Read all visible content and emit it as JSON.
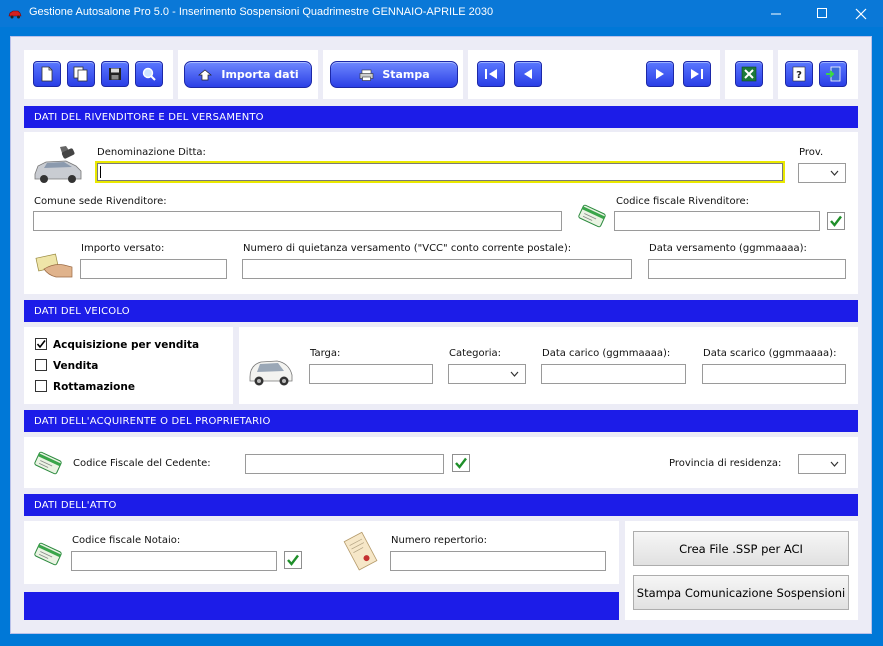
{
  "window": {
    "title": "Gestione Autosalone Pro 5.0 - Inserimento Sospensioni Quadrimestre GENNAIO-APRILE 2030",
    "minimize_glyph": "—",
    "maximize_glyph": "☐",
    "close_glyph": "✕"
  },
  "toolbar": {
    "import_label": "Importa dati",
    "print_label": "Stampa",
    "icons": [
      "new-doc-icon",
      "copy-icon",
      "save-icon",
      "search-icon",
      "first-record-icon",
      "prev-record-icon",
      "next-record-icon",
      "last-record-icon",
      "excel-icon",
      "help-icon",
      "exit-icon"
    ]
  },
  "sections": {
    "rivenditore": "DATI DEL RIVENDITORE E DEL VERSAMENTO",
    "veicolo": "DATI DEL VEICOLO",
    "acquirente": "DATI DELL'ACQUIRENTE O DEL PROPRIETARIO",
    "atto": "DATI DELL'ATTO"
  },
  "rivenditore": {
    "denominazione_label": "Denominazione Ditta:",
    "denominazione_value": "",
    "prov_label": "Prov.",
    "prov_value": "",
    "comune_label": "Comune sede Rivenditore:",
    "comune_value": "",
    "cf_label": "Codice fiscale Rivenditore:",
    "cf_value": "",
    "importo_label": "Importo versato:",
    "importo_value": "",
    "quietanza_label": "Numero di quietanza versamento (\"VCC\" conto corrente postale):",
    "quietanza_value": "",
    "data_label": "Data versamento (ggmmaaaa):",
    "data_value": ""
  },
  "veicolo": {
    "options": [
      {
        "label": "Acquisizione per vendita",
        "checked": true
      },
      {
        "label": "Vendita",
        "checked": false
      },
      {
        "label": "Rottamazione",
        "checked": false
      }
    ],
    "targa_label": "Targa:",
    "targa_value": "",
    "categoria_label": "Categoria:",
    "categoria_value": "",
    "carico_label": "Data carico (ggmmaaaa):",
    "carico_value": "",
    "scarico_label": "Data scarico (ggmmaaaa):",
    "scarico_value": ""
  },
  "acquirente": {
    "cf_label": "Codice Fiscale del Cedente:",
    "cf_value": "",
    "provincia_label": "Provincia di residenza:",
    "provincia_value": ""
  },
  "atto": {
    "notaio_label": "Codice fiscale Notaio:",
    "notaio_value": "",
    "repertorio_label": "Numero repertorio:",
    "repertorio_value": ""
  },
  "actions": {
    "create_file": "Crea File .SSP per ACI",
    "print_comm": "Stampa Comunicazione Sospensioni"
  },
  "colors": {
    "accent": "#1c1ce8",
    "titlebar": "#0a78d7",
    "focus": "#e9e800",
    "check_green": "#1f8f2a"
  }
}
